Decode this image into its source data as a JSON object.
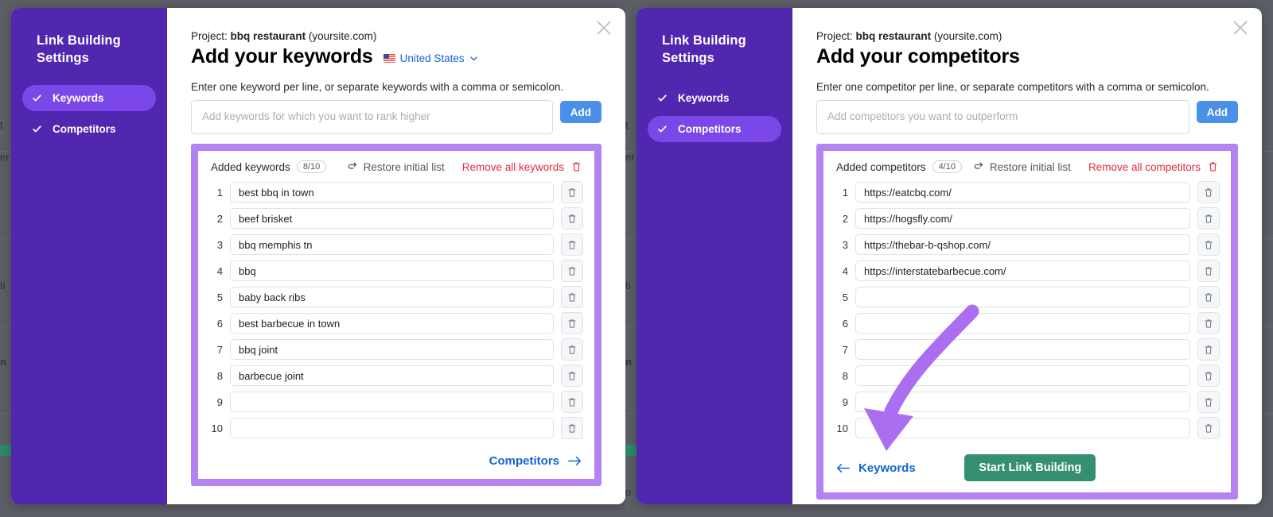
{
  "colors": {
    "backdrop": "#5c5f66",
    "sidebar_purple": "#5127b0",
    "sidebar_active": "#7b47e8",
    "highlight_border": "#b383f2",
    "add_button_blue": "#4a90e8",
    "link_blue": "#1464d6",
    "danger_red": "#e02d3c",
    "start_green": "#35906f",
    "annotation_arrow": "#ab6ef0"
  },
  "panels": [
    {
      "sidebar": {
        "title": "Link Building Settings",
        "items": [
          {
            "label": "Keywords",
            "active": true,
            "checked": true
          },
          {
            "label": "Competitors",
            "active": false,
            "checked": true
          }
        ]
      },
      "close_label": "Close",
      "project_prefix": "Project:",
      "project_name": "bbq restaurant",
      "project_domain": "(yoursite.com)",
      "heading": "Add your keywords",
      "locale": {
        "label": "United States",
        "flag": "us-flag-icon"
      },
      "hint": "Enter one keyword per line, or separate keywords with a comma or semicolon.",
      "input_placeholder": "Add keywords for which you want to rank higher",
      "input_value": "",
      "add_label": "Add",
      "list": {
        "title": "Added keywords",
        "count": "8/10",
        "restore_label": "Restore initial list",
        "remove_all_label": "Remove all keywords",
        "rows": [
          {
            "n": "1",
            "value": "best bbq in town"
          },
          {
            "n": "2",
            "value": "beef brisket"
          },
          {
            "n": "3",
            "value": "bbq memphis tn"
          },
          {
            "n": "4",
            "value": "bbq"
          },
          {
            "n": "5",
            "value": "baby back ribs"
          },
          {
            "n": "6",
            "value": "best barbecue in town"
          },
          {
            "n": "7",
            "value": "bbq joint"
          },
          {
            "n": "8",
            "value": "barbecue joint"
          },
          {
            "n": "9",
            "value": ""
          },
          {
            "n": "10",
            "value": ""
          }
        ]
      },
      "footer": {
        "back_label": "",
        "next_label": "Competitors",
        "primary_label": ""
      }
    },
    {
      "sidebar": {
        "title": "Link Building Settings",
        "items": [
          {
            "label": "Keywords",
            "active": false,
            "checked": true
          },
          {
            "label": "Competitors",
            "active": true,
            "checked": true
          }
        ]
      },
      "close_label": "Close",
      "project_prefix": "Project:",
      "project_name": "bbq restaurant",
      "project_domain": "(yoursite.com)",
      "heading": "Add your competitors",
      "locale": null,
      "hint": "Enter one competitor per line, or separate competitors with a comma or semicolon.",
      "input_placeholder": "Add competitors you want to outperform",
      "input_value": "",
      "add_label": "Add",
      "list": {
        "title": "Added competitors",
        "count": "4/10",
        "restore_label": "Restore initial list",
        "remove_all_label": "Remove all competitors",
        "rows": [
          {
            "n": "1",
            "value": "https://eatcbq.com/"
          },
          {
            "n": "2",
            "value": "https://hogsfly.com/"
          },
          {
            "n": "3",
            "value": "https://thebar-b-qshop.com/"
          },
          {
            "n": "4",
            "value": "https://interstatebarbecue.com/"
          },
          {
            "n": "5",
            "value": ""
          },
          {
            "n": "6",
            "value": ""
          },
          {
            "n": "7",
            "value": ""
          },
          {
            "n": "8",
            "value": ""
          },
          {
            "n": "9",
            "value": ""
          },
          {
            "n": "10",
            "value": ""
          }
        ]
      },
      "footer": {
        "back_label": "Keywords",
        "next_label": "",
        "primary_label": "Start Link Building"
      }
    }
  ],
  "background_hints": {
    "left": [
      "t",
      "er",
      "ti",
      "n"
    ],
    "right": [
      "t",
      "er",
      "ti",
      "n",
      "o"
    ]
  }
}
